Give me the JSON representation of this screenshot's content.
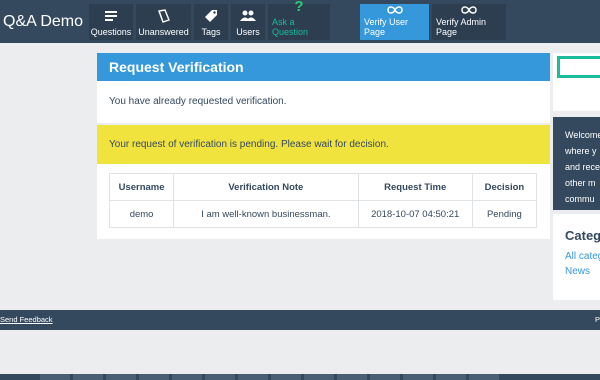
{
  "brand": "Q&A Demo",
  "nav": {
    "questions": "Questions",
    "unanswered": "Unanswered",
    "tags": "Tags",
    "users": "Users",
    "ask": "Ask a Question",
    "verify_user": "Verify User Page",
    "verify_admin": "Verify Admin Page"
  },
  "panel": {
    "title": "Request Verification",
    "message": "You have already requested verification.",
    "alert": "Your request of verification is pending. Please wait for decision."
  },
  "table": {
    "headers": [
      "Username",
      "Verification Note",
      "Request Time",
      "Decision"
    ],
    "rows": [
      [
        "demo",
        "I am well-known businessman.",
        "2018-10-07 04:50:21",
        "Pending"
      ]
    ]
  },
  "sidebar": {
    "welcome_lines": [
      "Welcome",
      "where y",
      "and rece",
      "other m",
      "commu"
    ],
    "categories_title": "Categ",
    "links": [
      "All categ",
      "News"
    ]
  },
  "footer": {
    "feedback": "Send Feedback",
    "right": "P"
  },
  "colors": {
    "nav_bg": "#34495e",
    "accent": "#3498db",
    "alert": "#f1e33d",
    "ask_green": "#1abc9c"
  }
}
